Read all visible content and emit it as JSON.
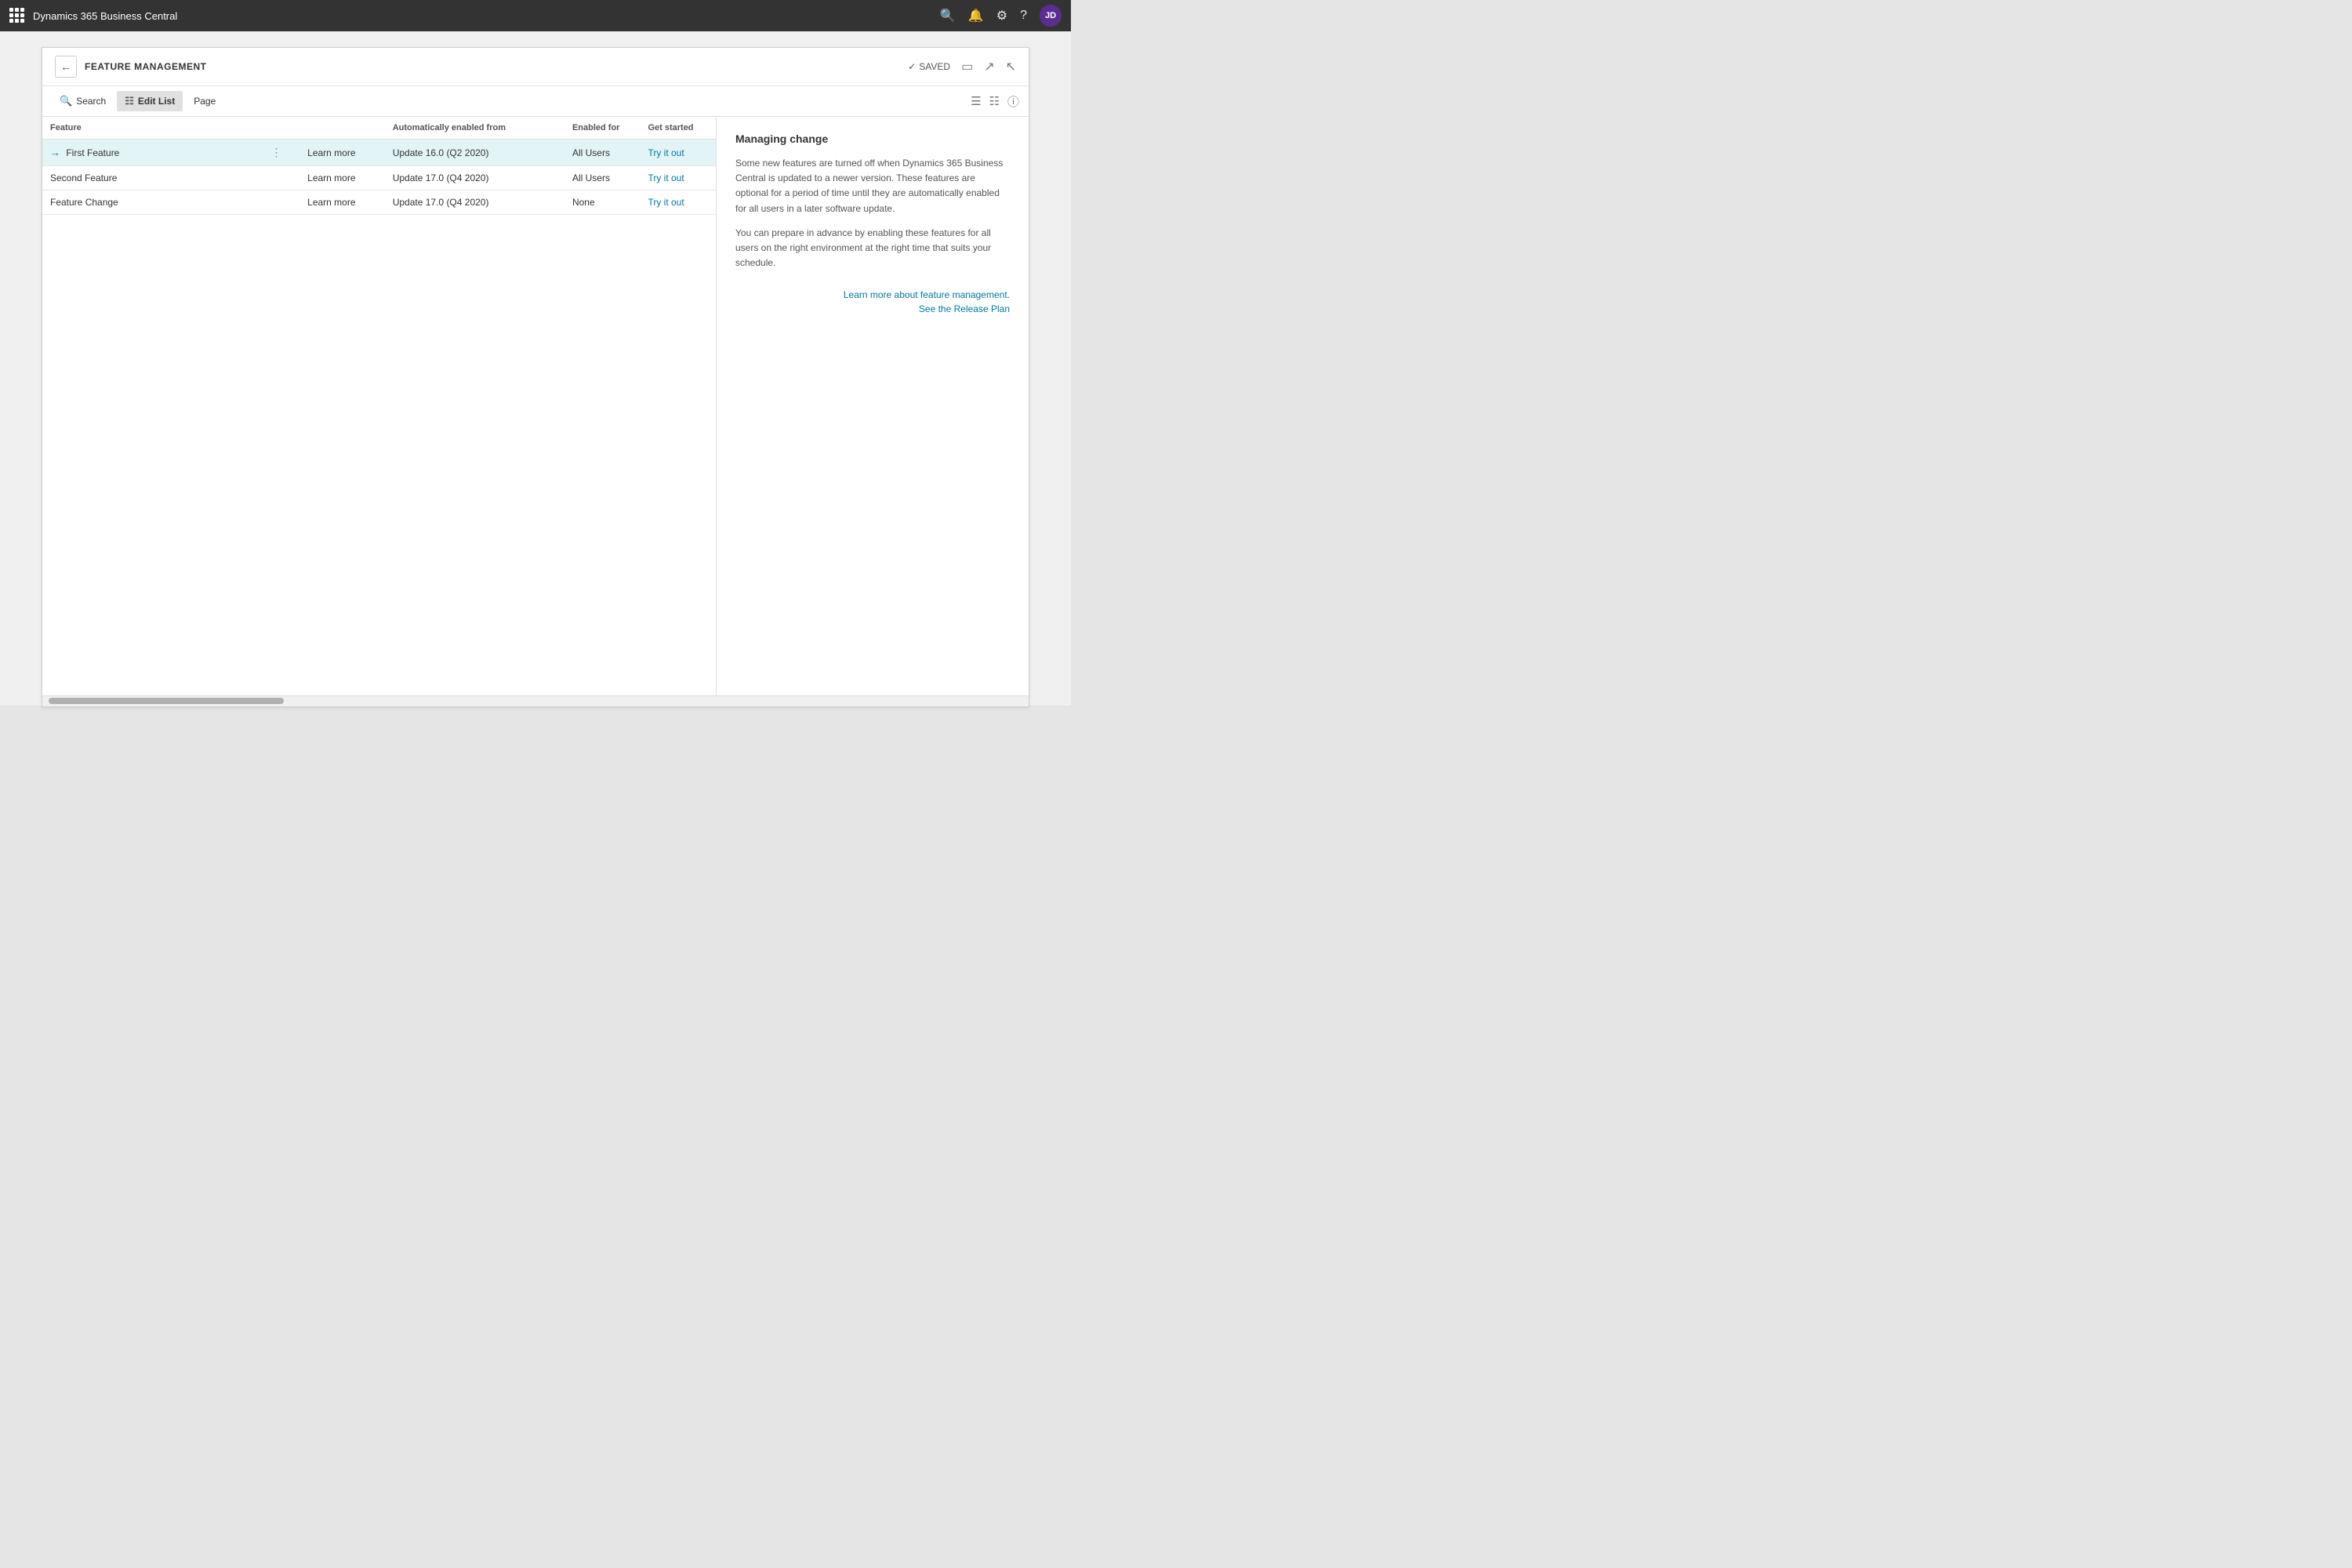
{
  "topnav": {
    "title": "Dynamics 365 Business Central",
    "avatar_initials": "JD"
  },
  "page": {
    "title": "FEATURE MANAGEMENT",
    "saved_label": "SAVED"
  },
  "toolbar": {
    "search_label": "Search",
    "edit_list_label": "Edit List",
    "page_label": "Page"
  },
  "table": {
    "columns": {
      "feature": "Feature",
      "auto_enabled": "Automatically enabled from",
      "enabled_for": "Enabled for",
      "get_started": "Get started"
    },
    "rows": [
      {
        "name": "First Feature",
        "learn_more": "Learn more",
        "auto_enabled": "Update 16.0 (Q2 2020)",
        "enabled_for": "All Users",
        "get_started": "Try it out",
        "selected": true
      },
      {
        "name": "Second Feature",
        "learn_more": "Learn more",
        "auto_enabled": "Update 17.0 (Q4 2020)",
        "enabled_for": "All Users",
        "get_started": "Try it out",
        "selected": false
      },
      {
        "name": "Feature Change",
        "learn_more": "Learn more",
        "auto_enabled": "Update 17.0 (Q4 2020)",
        "enabled_for": "None",
        "get_started": "Try it out",
        "selected": false
      }
    ]
  },
  "info_panel": {
    "title": "Managing change",
    "paragraph1": "Some new features are turned off when Dynamics 365 Business Central is updated to a newer version. These features are optional for a period of time until they are automatically enabled for all users in a later software update.",
    "paragraph2": "You can prepare in advance by enabling these features for all users on the right environment at the right time that suits your schedule.",
    "link1": "Learn more about feature management.",
    "link2": "See the Release Plan"
  }
}
